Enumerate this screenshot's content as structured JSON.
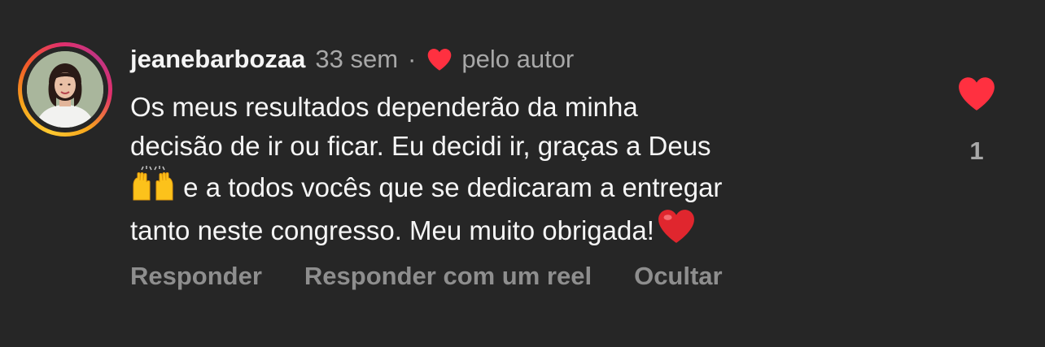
{
  "comment": {
    "username": "jeanebarbozaa",
    "time": "33 sem",
    "separator": "·",
    "liked_by_author_label": "pelo autor",
    "text_line1": "Os meus resultados dependerão da minha",
    "text_line2": "decisão de ir ou ficar. Eu decidi ir, graças a Deus",
    "text_line3": " e a todos vocês que se dedicaram a entregar",
    "text_line4": "tanto neste congresso. Meu muito obrigada!",
    "like_count": "1",
    "actions": {
      "reply": "Responder",
      "reply_reel": "Responder com um reel",
      "hide": "Ocultar"
    }
  },
  "colors": {
    "background": "#262626",
    "heart": "#ff3040",
    "muted_text": "#a8a8a8",
    "action_text": "#8e8e8e"
  },
  "icons": {
    "author_like": "heart-icon",
    "raised_hands": "raised-hands-emoji",
    "red_heart": "red-heart-emoji",
    "like_button": "heart-icon"
  }
}
